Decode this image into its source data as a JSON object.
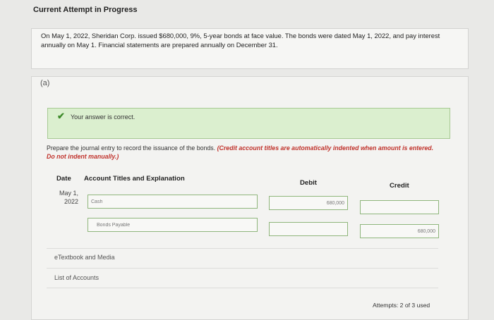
{
  "header": {
    "title": "Current Attempt in Progress"
  },
  "problem": {
    "text": "On May 1, 2022, Sheridan Corp. issued $680,000, 9%, 5-year bonds at face value. The bonds were dated May 1, 2022, and pay interest annually on May 1. Financial statements are prepared annually on December 31."
  },
  "part": {
    "label": "(a)",
    "success_message": "Your answer is correct.",
    "instructions": "Prepare the journal entry to record the issuance of the bonds.",
    "instructions_note": "(Credit account titles are automatically indented when amount is entered. Do not indent manually.)"
  },
  "journal": {
    "headers": {
      "date": "Date",
      "account": "Account Titles and Explanation",
      "debit": "Debit",
      "credit": "Credit"
    },
    "date_line1": "May 1,",
    "date_line2": "2022",
    "rows": [
      {
        "account": "Cash",
        "debit": "680,000",
        "credit": ""
      },
      {
        "account": "Bonds Payable",
        "debit": "",
        "credit": "680,000"
      }
    ]
  },
  "links": {
    "etextbook": "eTextbook and Media",
    "accounts": "List of Accounts"
  },
  "footer": {
    "attempts": "Attempts: 2 of 3 used"
  },
  "colors": {
    "success_bg": "#dbefcf",
    "success_check": "#3d8a29",
    "note_red": "#c0322b"
  },
  "icons": {
    "success": "checkmark-icon"
  }
}
